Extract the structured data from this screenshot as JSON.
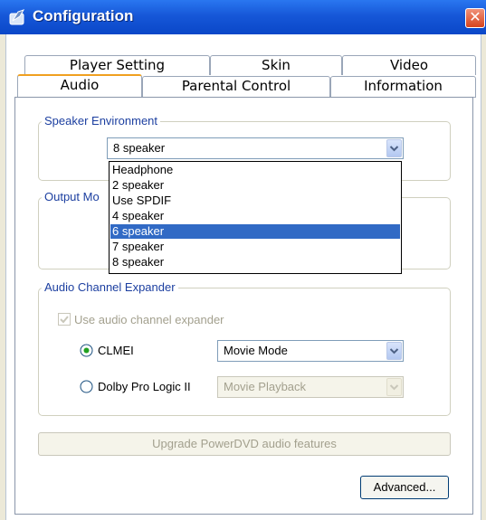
{
  "window": {
    "title": "Configuration",
    "close_label": "✕"
  },
  "tabs": {
    "back": [
      "Player Setting",
      "Skin",
      "Video"
    ],
    "front": [
      "Audio",
      "Parental Control",
      "Information"
    ],
    "active": "Audio"
  },
  "speaker_environment": {
    "legend": "Speaker Environment",
    "selected": "8 speaker",
    "options": [
      "Headphone",
      "2 speaker",
      "Use SPDIF",
      "4 speaker",
      "6 speaker",
      "7 speaker",
      "8 speaker"
    ],
    "highlighted": "6 speaker"
  },
  "output_mode": {
    "legend_visible": "Output Mo"
  },
  "audio_channel_expander": {
    "legend": "Audio Channel Expander",
    "checkbox_label": "Use audio channel expander",
    "checkbox_checked": true,
    "clmei_label": "CLMEI",
    "clmei_mode": "Movie Mode",
    "dolby_label": "Dolby Pro Logic II",
    "dolby_mode": "Movie Playback",
    "selected_radio": "CLMEI"
  },
  "buttons": {
    "upgrade": "Upgrade PowerDVD audio features",
    "advanced": "Advanced..."
  },
  "colors": {
    "accent": "#316ac5",
    "title_bar": "#1657d8",
    "legend_text": "#1c3fa0",
    "active_tab_top": "#f0a020"
  }
}
